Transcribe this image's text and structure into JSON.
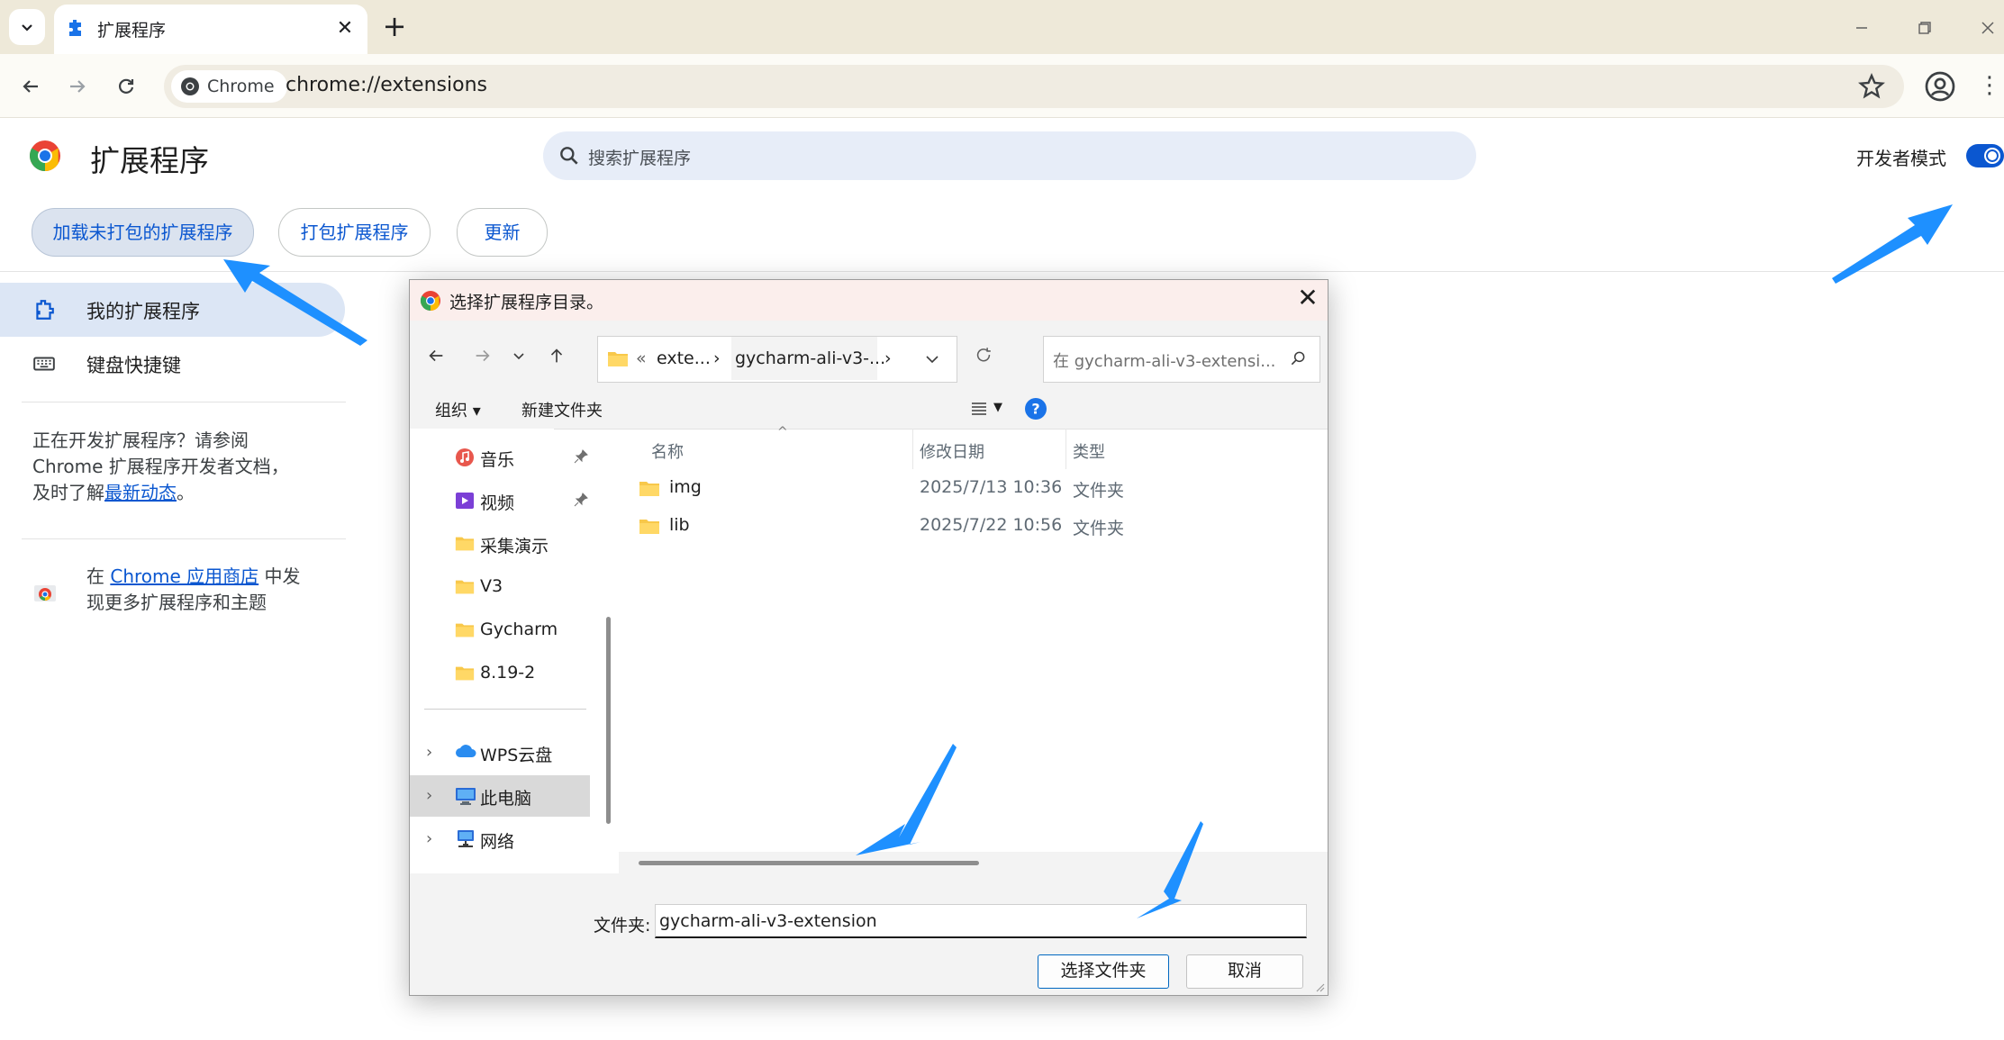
{
  "browser": {
    "tab_title": "扩展程序",
    "new_tab": "+",
    "tab_close": "✕",
    "chip_label": "Chrome",
    "url": "chrome://extensions"
  },
  "page": {
    "title": "扩展程序",
    "search_placeholder": "搜索扩展程序",
    "dev_mode_label": "开发者模式",
    "dev_mode_enabled": true,
    "buttons": {
      "load_unpacked": "加载未打包的扩展程序",
      "pack": "打包扩展程序",
      "update": "更新"
    },
    "sidebar": {
      "my_extensions": "我的扩展程序",
      "shortcuts": "键盘快捷键"
    },
    "dev_info": {
      "line1": "正在开发扩展程序？请参阅",
      "line2": "Chrome 扩展程序开发者文档，",
      "line3_prefix": "及时了解",
      "line3_link": "最新动态",
      "line3_suffix": "。"
    },
    "store_info": {
      "prefix": "在 ",
      "link": "Chrome 应用商店",
      "suffix": " 中发",
      "line2": "现更多扩展程序和主题"
    }
  },
  "dialog": {
    "title": "选择扩展程序目录。",
    "close": "✕",
    "breadcrumbs": [
      "«",
      "exte...",
      "›",
      "gycharm-ali-v3-...",
      "›"
    ],
    "search_placeholder": "在 gycharm-ali-v3-extensi...",
    "commands": {
      "organize": "组织",
      "new_folder": "新建文件夹"
    },
    "nav_items": [
      {
        "label": "音乐",
        "icon": "music-icon",
        "pinned": true
      },
      {
        "label": "视频",
        "icon": "video-icon",
        "pinned": true
      },
      {
        "label": "采集演示",
        "icon": "folder-icon",
        "pinned": false
      },
      {
        "label": "V3",
        "icon": "folder-icon",
        "pinned": false
      },
      {
        "label": "Gycharm",
        "icon": "folder-icon",
        "pinned": false
      },
      {
        "label": "8.19-2",
        "icon": "folder-icon",
        "pinned": false
      },
      {
        "label": "WPS云盘",
        "icon": "cloud-icon",
        "pinned": false
      },
      {
        "label": "此电脑",
        "icon": "computer-icon",
        "pinned": false,
        "selected": true
      },
      {
        "label": "网络",
        "icon": "network-icon",
        "pinned": false
      }
    ],
    "columns": {
      "name": "名称",
      "modified": "修改日期",
      "type": "类型"
    },
    "files": [
      {
        "name": "img",
        "modified": "2025/7/13 10:36",
        "type": "文件夹"
      },
      {
        "name": "lib",
        "modified": "2025/7/22 10:56",
        "type": "文件夹"
      }
    ],
    "folder_label": "文件夹:",
    "folder_value": "gycharm-ali-v3-extension",
    "select_button": "选择文件夹",
    "cancel_button": "取消"
  },
  "colors": {
    "accent": "#0b57d0",
    "annotation_arrow": "#1e90ff",
    "titlebar": "#eee9d9"
  }
}
